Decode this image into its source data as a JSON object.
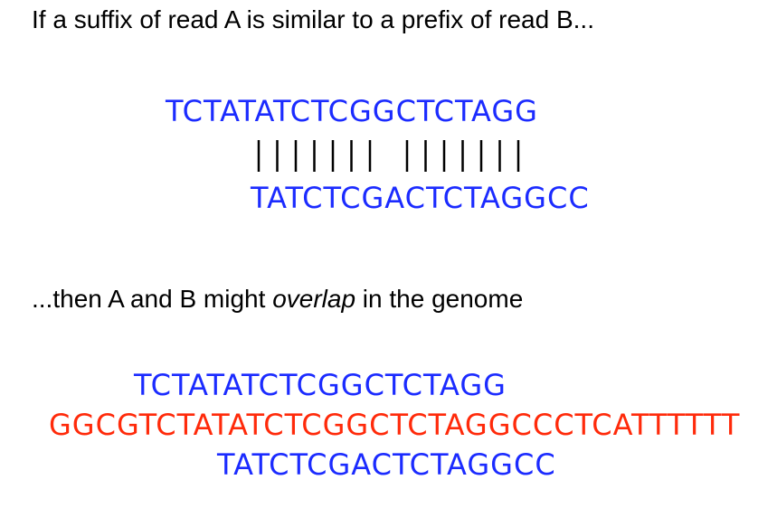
{
  "caption_top": "If a suffix of read A is similar to a prefix of read B...",
  "caption_bottom": {
    "before": "...then A and B might ",
    "emphasis": "overlap",
    "after": " in the genome"
  },
  "alignment": {
    "read_a": "TCTATATCTCGGCTCTAGG",
    "read_b": "TATCTCGACTCTAGGCC",
    "match_pattern": "|||||||.|||||||"
  },
  "genome_layout": {
    "read_a": "TCTATATCTCGGCTCTAGG",
    "genome": "GGCGTCTATATCTCGGCTCTAGGCCCTCATTTTTT",
    "read_b": "TATCTCGACTCTAGGCC"
  },
  "colors": {
    "read": "#1b2bff",
    "genome": "#ff2a0a",
    "text": "#000000"
  }
}
